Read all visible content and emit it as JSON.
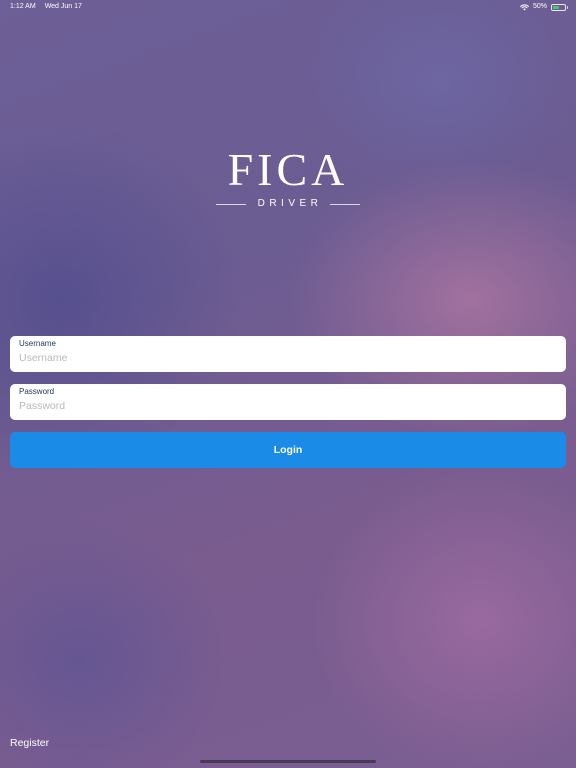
{
  "status_bar": {
    "time": "1:12 AM",
    "date": "Wed Jun 17",
    "battery_percent": "50%",
    "wifi_icon": "wifi-icon",
    "battery_icon": "battery-icon",
    "battery_level": 0.5,
    "battery_color": "#3fd15a"
  },
  "logo": {
    "title": "FICA",
    "subtitle": "DRIVER"
  },
  "form": {
    "username": {
      "label": "Username",
      "placeholder": "Username",
      "value": ""
    },
    "password": {
      "label": "Password",
      "placeholder": "Password",
      "value": ""
    },
    "login_label": "Login",
    "login_color": "#1a8be6"
  },
  "footer": {
    "register_label": "Register"
  }
}
